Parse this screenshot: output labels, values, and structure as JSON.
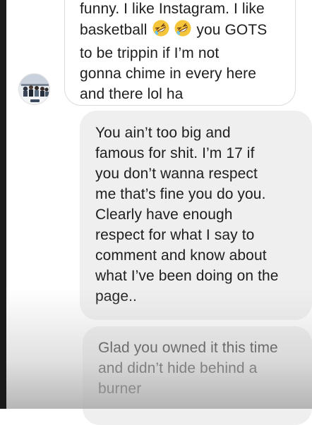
{
  "conversation": {
    "incoming": {
      "sender_avatar": "avatar-photo",
      "text_lines": [
        "funny. I like Instagram. I like",
        "basketball",
        "you GOTS",
        "to be trippin if I’m not",
        "gonna chime in every here",
        "and there lol ha"
      ],
      "emoji": [
        "rolling-on-floor-laughing-emoji",
        "rolling-on-floor-laughing-emoji"
      ]
    },
    "outgoing": [
      {
        "text": "You ain’t too big and\nfamous for shit. I’m 17 if\nyou don’t wanna respect\nme that’s fine you do you.\nClearly have enough\nrespect for what I say to\ncomment and know about\nwhat I’ve been doing on the\npage.."
      },
      {
        "text": "Glad you owned it this time\nand didn’t hide behind a\nburner"
      }
    ]
  },
  "colors": {
    "outgoing_bubble": "#efefef",
    "incoming_border": "#dcdcdc",
    "text": "#1e1e1e",
    "emoji_face": "#f4c53a"
  }
}
